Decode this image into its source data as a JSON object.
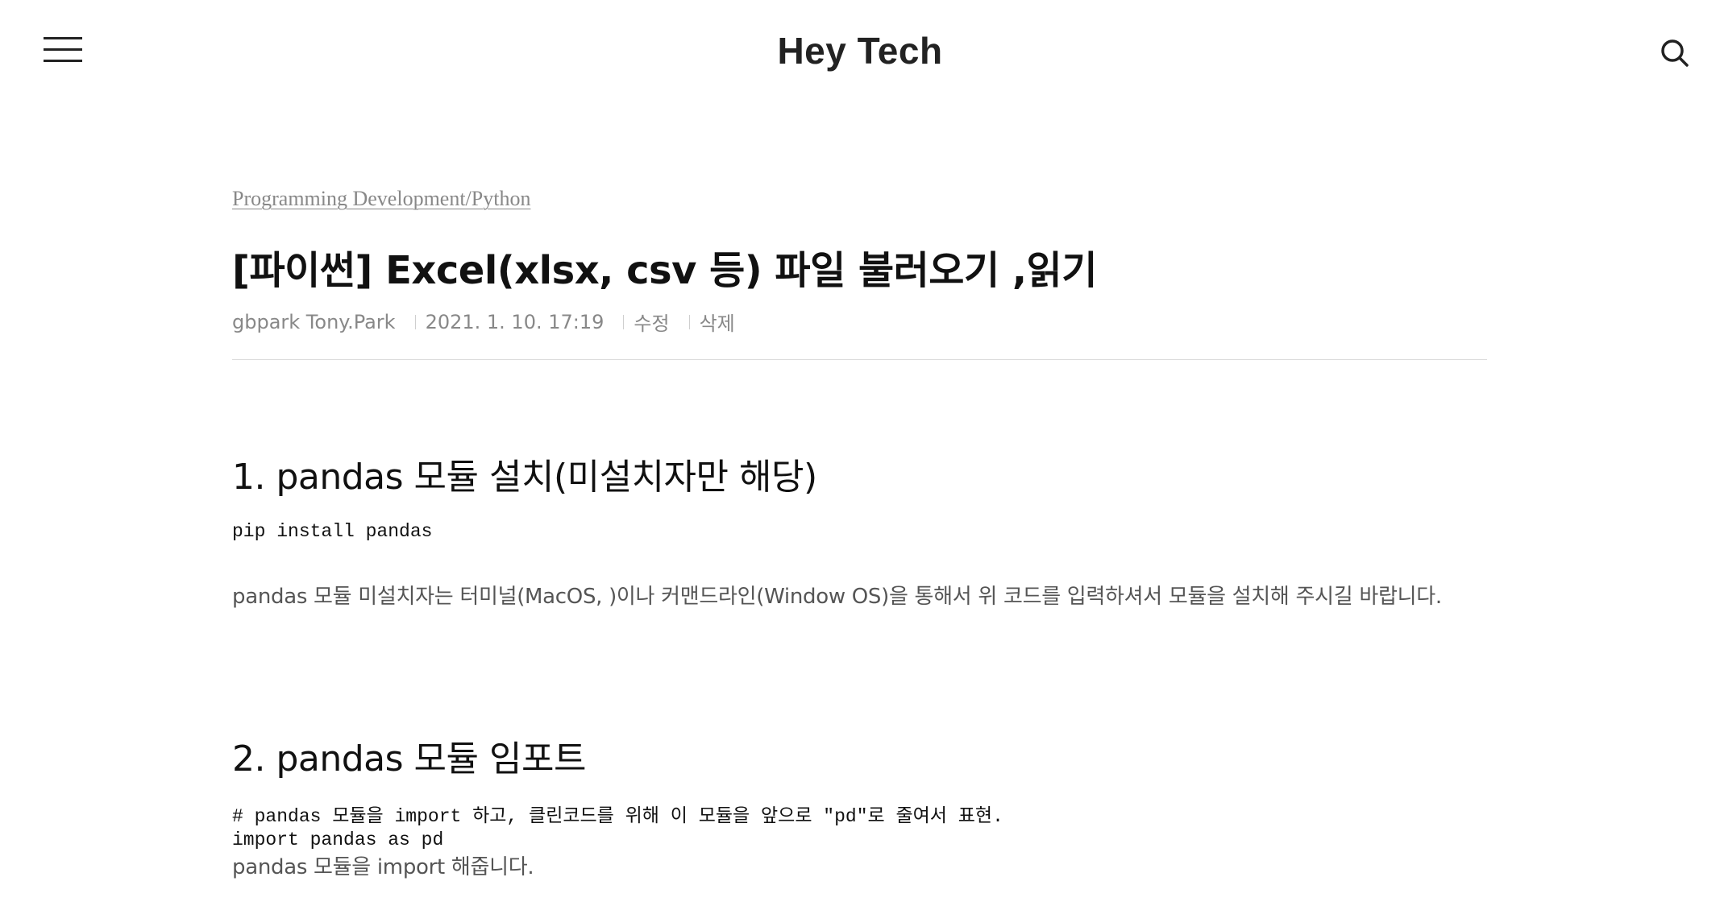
{
  "header": {
    "site_title": "Hey Tech",
    "menu_icon": "hamburger-menu-icon",
    "search_icon": "search-icon"
  },
  "post": {
    "category": "Programming Development/Python",
    "title": "[파이썬] Excel(xlsx, csv 등) 파일 불러오기 ,읽기",
    "meta": {
      "author": "gbpark Tony.Park",
      "date": "2021. 1. 10. 17:19",
      "edit_label": "수정",
      "delete_label": "삭제"
    }
  },
  "sections": [
    {
      "heading": "1. pandas 모듈 설치(미설치자만 해당)",
      "code": "pip install pandas",
      "paragraph": "pandas 모듈 미설치자는 터미널(MacOS, )이나 커맨드라인(Window OS)을 통해서 위 코드를 입력하셔서 모듈을 설치해 주시길 바랍니다."
    },
    {
      "heading": "2. pandas 모듈 임포트",
      "code_lines": [
        "# pandas 모듈을 import 하고, 클린코드를 위해 이 모듈을 앞으로 \"pd\"로 줄여서 표현.",
        "import pandas as pd"
      ],
      "paragraph": "pandas 모듈을 import 해줍니다."
    }
  ]
}
